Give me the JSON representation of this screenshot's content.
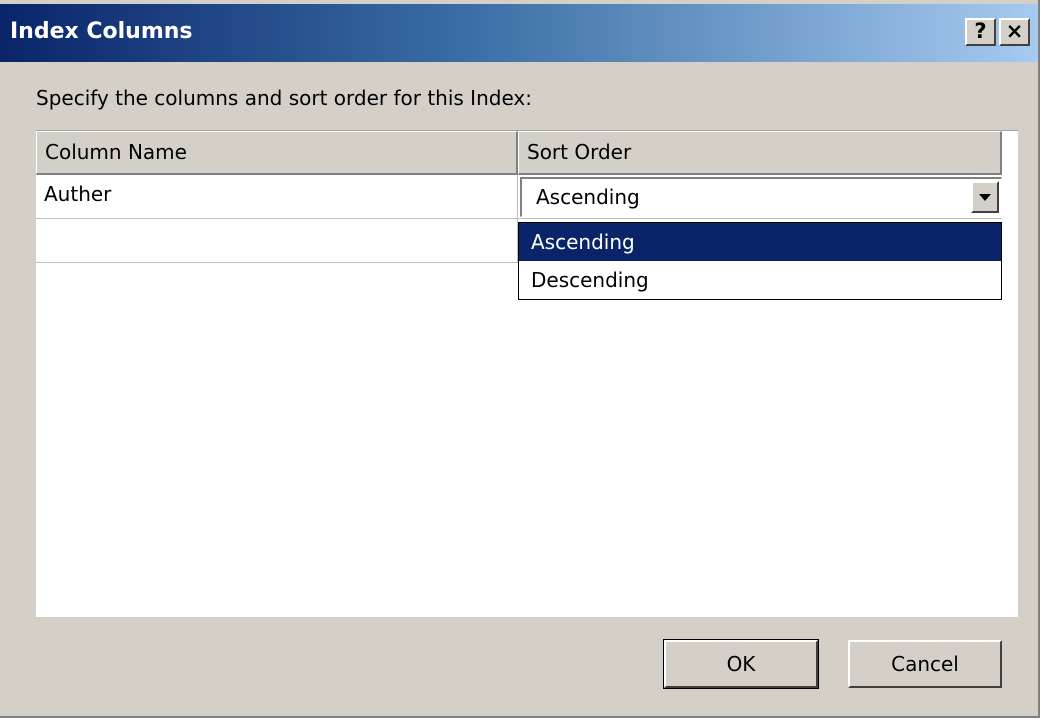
{
  "window": {
    "title": "Index Columns",
    "help_label": "?",
    "close_label": "×"
  },
  "instruction": "Specify the columns and sort order for this Index:",
  "grid": {
    "columns": [
      "Column Name",
      "Sort Order"
    ],
    "rows": [
      {
        "column_name": "Auther",
        "sort_order": "Ascending"
      },
      {
        "column_name": "",
        "sort_order": ""
      }
    ]
  },
  "sort_dropdown": {
    "selected": "Ascending",
    "options": [
      "Ascending",
      "Descending"
    ],
    "highlighted": "Ascending"
  },
  "buttons": {
    "ok": "OK",
    "cancel": "Cancel"
  },
  "colors": {
    "title_gradient_start": "#0a246a",
    "title_gradient_end": "#a6caf0",
    "dialog_face": "#d4d0c8",
    "selection": "#0a246a"
  }
}
